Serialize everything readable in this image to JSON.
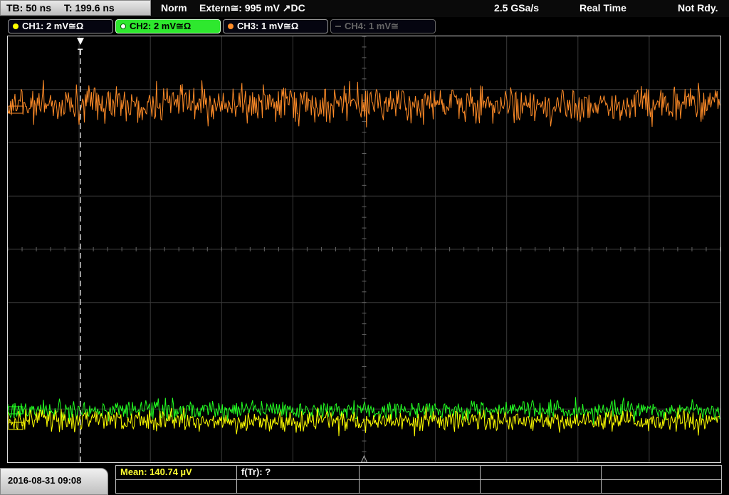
{
  "status": {
    "timebase": "TB: 50 ns",
    "trigger_time": "T: 199.6 ns",
    "trigger_mode": "Norm",
    "trigger_source": "Extern≅: 995 mV ↗DC",
    "sample_rate": "2.5 GSa/s",
    "acq_mode": "Real Time",
    "ready_state": "Not Rdy."
  },
  "channels": [
    {
      "label": "CH1: 2 mV≅Ω",
      "color": "#ffff00",
      "state": "on"
    },
    {
      "label": "CH2: 2 mV≅Ω",
      "color": "#22ff22",
      "state": "active"
    },
    {
      "label": "CH3: 1 mV≅Ω",
      "color": "#ff8c28",
      "state": "on"
    },
    {
      "label": "CH4: 1 mV≅",
      "color": "#555555",
      "state": "off"
    }
  ],
  "trigger_marker": "T",
  "measurements": {
    "mean": "Mean: 140.74 µV",
    "rise": "f(Tr): ?"
  },
  "datetime": "2016-08-31 09:08",
  "colors": {
    "grid": "#3a3a3a",
    "ch1": "#ffff00",
    "ch2": "#22ff22",
    "ch3": "#ff8c28"
  }
}
